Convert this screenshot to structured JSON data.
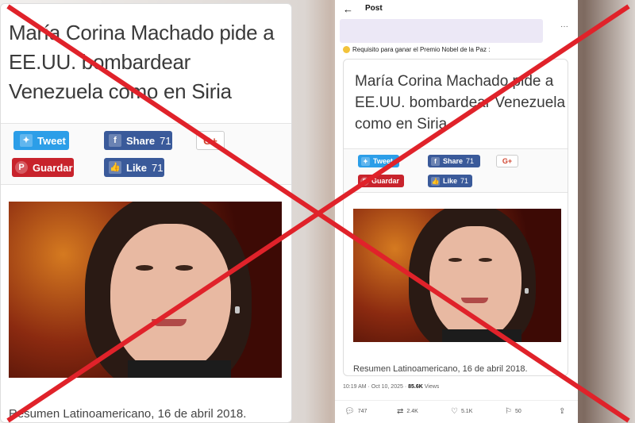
{
  "left_card": {
    "headline": "María Corina Machado pide a EE.UU. bombardear Venezuela como en Siria",
    "buttons": {
      "tweet": "Tweet",
      "share": "Share",
      "share_count": "71",
      "gplus": "G+",
      "guardar": "Guardar",
      "like": "Like",
      "like_count": "71"
    },
    "caption": "Resumen Latinoamericano, 16 de abril 2018."
  },
  "post": {
    "header_title": "Post",
    "text": "Requisito para ganar el Premio Nobel de la Paz :",
    "card": {
      "headline": "María Corina Machado pide a EE.UU. bombardear Venezuela como en Siria",
      "buttons": {
        "tweet": "Tweet",
        "share": "Share",
        "share_count": "71",
        "gplus": "G+",
        "guardar": "Guardar",
        "like": "Like",
        "like_count": "71"
      },
      "caption": "Resumen Latinoamericano, 16 de abril 2018."
    },
    "meta": {
      "time": "10:19 AM · Oct 10, 2025 ·",
      "views_count": "85.6K",
      "views_label": "Views"
    },
    "actions": {
      "replies": "747",
      "reposts": "2.4K",
      "likes": "5.1K",
      "bookmarks": "50"
    }
  },
  "overlay": {
    "cross_color": "#e0222a"
  }
}
